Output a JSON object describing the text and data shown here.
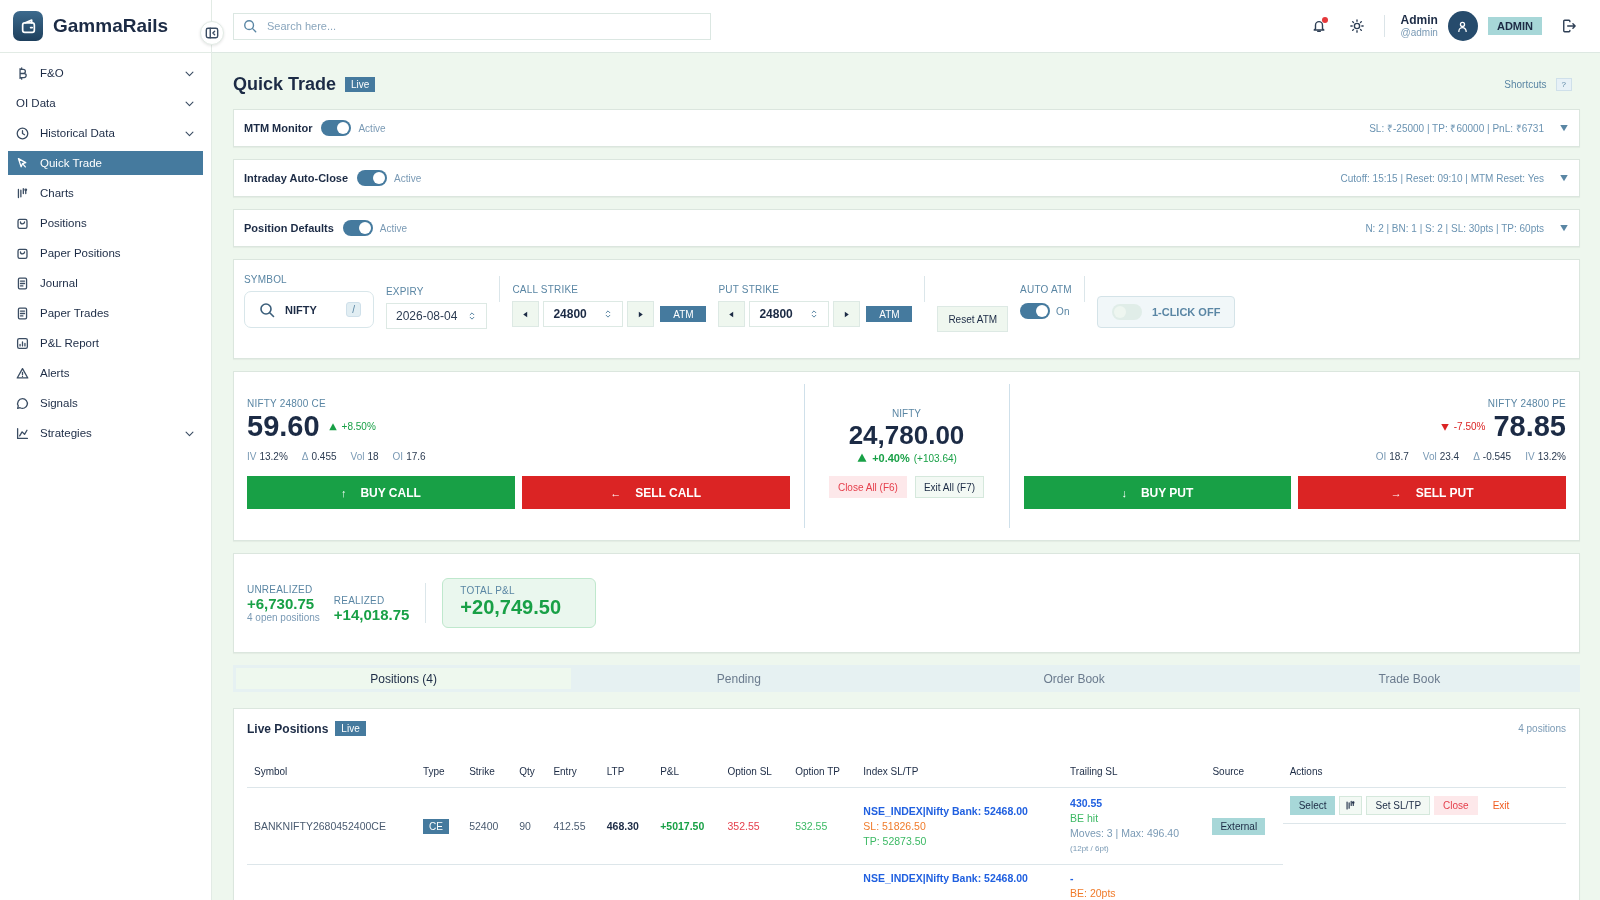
{
  "app": {
    "name": "GammaRails"
  },
  "search": {
    "placeholder": "Search here..."
  },
  "user": {
    "name": "Admin",
    "handle": "@admin",
    "role": "ADMIN",
    "unread": true
  },
  "sidebar": {
    "items": [
      {
        "label": "F&O",
        "expandable": true,
        "selected": false
      },
      {
        "label": "OI Data",
        "expandable": true,
        "selected": false
      },
      {
        "label": "Historical Data",
        "expandable": true,
        "selected": false
      },
      {
        "label": "Quick Trade",
        "expandable": false,
        "selected": true
      },
      {
        "label": "Charts",
        "expandable": false,
        "selected": false
      },
      {
        "label": "Positions",
        "expandable": false,
        "selected": false
      },
      {
        "label": "Paper Positions",
        "expandable": false,
        "selected": false
      },
      {
        "label": "Journal",
        "expandable": false,
        "selected": false
      },
      {
        "label": "Paper Trades",
        "expandable": false,
        "selected": false
      },
      {
        "label": "P&L Report",
        "expandable": false,
        "selected": false
      },
      {
        "label": "Alerts",
        "expandable": false,
        "selected": false
      },
      {
        "label": "Signals",
        "expandable": false,
        "selected": false
      },
      {
        "label": "Strategies",
        "expandable": true,
        "selected": false
      }
    ]
  },
  "page": {
    "title": "Quick Trade",
    "badge": "Live",
    "shortcuts": {
      "label": "Shortcuts",
      "key": "?"
    }
  },
  "monitors": [
    {
      "label": "MTM Monitor",
      "on": true,
      "status": "Active",
      "summary": "SL: ₹-25000 | TP: ₹60000 | PnL: ₹6731"
    },
    {
      "label": "Intraday Auto-Close",
      "on": true,
      "status": "Active",
      "summary": "Cutoff: 15:15 | Reset: 09:10 | MTM Reset: Yes"
    },
    {
      "label": "Position Defaults",
      "on": true,
      "status": "Active",
      "summary": "N: 2 | BN: 1 | S: 2 | SL: 30pts | TP: 60pts"
    }
  ],
  "controls": {
    "symbol": {
      "label": "SYMBOL",
      "value": "NIFTY",
      "shortcut": "/"
    },
    "expiry": {
      "label": "EXPIRY",
      "value": "2026-08-04"
    },
    "strikes": [
      {
        "label": "CALL STRIKE",
        "value": "24800",
        "atm": "ATM"
      },
      {
        "label": "PUT STRIKE",
        "value": "24800",
        "atm": "ATM"
      }
    ],
    "reset": "Reset ATM",
    "auto_atm": {
      "label": "AUTO ATM",
      "on": true,
      "status": "On"
    },
    "one_click": {
      "label": "1-CLICK OFF",
      "on": false
    }
  },
  "quotes": {
    "call": {
      "title": "NIFTY 24800 CE",
      "price": "59.60",
      "change": "+8.50%",
      "rising": true,
      "stats": [
        {
          "label": "IV",
          "value": "13.2%"
        },
        {
          "label": "Δ",
          "value": "0.455"
        },
        {
          "label": "Vol",
          "value": "18"
        },
        {
          "label": "OI",
          "value": "17.6"
        }
      ],
      "buttons": [
        {
          "arrow": "↑",
          "label": "BUY CALL",
          "kind": "buy"
        },
        {
          "arrow": "←",
          "label": "SELL CALL",
          "kind": "sell"
        }
      ]
    },
    "index": {
      "name": "NIFTY",
      "value": "24,780.00",
      "change": "+0.40%",
      "change_abs": "(+103.64)",
      "rising": true,
      "actions": [
        {
          "label": "Close All (F6)",
          "kind": "danger"
        },
        {
          "label": "Exit All (F7)",
          "kind": "plain"
        }
      ]
    },
    "put": {
      "title": "NIFTY 24800 PE",
      "price": "78.85",
      "change": "-7.50%",
      "rising": false,
      "stats": [
        {
          "label": "OI",
          "value": "18.7"
        },
        {
          "label": "Vol",
          "value": "23.4"
        },
        {
          "label": "Δ",
          "value": "-0.545"
        },
        {
          "label": "IV",
          "value": "13.2%"
        }
      ],
      "buttons": [
        {
          "arrow": "↓",
          "label": "BUY PUT",
          "kind": "buy"
        },
        {
          "arrow": "→",
          "label": "SELL PUT",
          "kind": "sell"
        }
      ]
    }
  },
  "pnl": {
    "unrealized": {
      "label": "UNREALIZED",
      "value": "+6,730.75",
      "note": "4 open positions"
    },
    "realized": {
      "label": "REALIZED",
      "value": "+14,018.75"
    },
    "total": {
      "label": "TOTAL P&L",
      "value": "+20,749.50"
    }
  },
  "tabs": [
    {
      "label": "Positions (4)",
      "selected": true
    },
    {
      "label": "Pending",
      "selected": false
    },
    {
      "label": "Order Book",
      "selected": false
    },
    {
      "label": "Trade Book",
      "selected": false
    }
  ],
  "positions": {
    "title": "Live Positions",
    "badge": "Live",
    "count": "4 positions",
    "columns": [
      "Symbol",
      "Type",
      "Strike",
      "Qty",
      "Entry",
      "LTP",
      "P&L",
      "Option SL",
      "Option TP",
      "Index SL/TP",
      "Trailing SL",
      "Source",
      "Actions"
    ],
    "rows": [
      {
        "symbol": "BANKNIFTY2680452400CE",
        "type": "CE",
        "is_put": false,
        "strike": "52400",
        "qty": "90",
        "entry": "412.55",
        "ltp": "468.30",
        "pnl": "+5017.50",
        "pnl_positive": true,
        "option_sl": "352.55",
        "option_tp": "532.55",
        "index_level": "NSE_INDEX|Nifty Bank: 52468.00",
        "index_sl": "SL: 51826.50",
        "index_tp": "TP: 52873.50",
        "trailing": {
          "value": "430.55",
          "status": "BE hit",
          "be_hit": true,
          "moves": "Moves: 3 | Max: 496.40",
          "step": "(12pt / 6pt)"
        },
        "source": "External",
        "from_signal": false,
        "actions": [
          {
            "kind": "select",
            "label": "Select"
          },
          {
            "kind": "chart"
          },
          {
            "kind": "sltp",
            "label": "Set SL/TP"
          },
          {
            "kind": "close",
            "label": "Close"
          },
          {
            "kind": "exit",
            "label": "Exit"
          }
        ]
      },
      {
        "index_level": "NSE_INDEX|Nifty Bank: 52468.00",
        "trailing": {
          "value": "-",
          "status": "BE: 20pts",
          "be_hit": false
        }
      }
    ]
  }
}
